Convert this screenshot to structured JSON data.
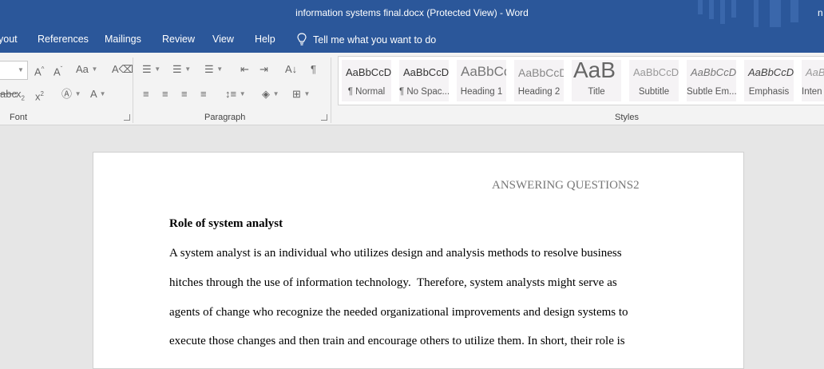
{
  "window": {
    "title": "information systems final.docx (Protected View)  -  Word",
    "user_initial": "n"
  },
  "tabs": [
    "yout",
    "References",
    "Mailings",
    "Review",
    "View",
    "Help"
  ],
  "tell_me": "Tell me what you want to do",
  "ribbon": {
    "groups": {
      "font": "Font",
      "paragraph": "Paragraph",
      "styles": "Styles"
    },
    "styles": [
      {
        "sample": "AaBbCcDc",
        "name": "¶ Normal"
      },
      {
        "sample": "AaBbCcDc",
        "name": "¶ No Spac..."
      },
      {
        "sample": "AaBbCc",
        "name": "Heading 1"
      },
      {
        "sample": "AaBbCcD",
        "name": "Heading 2"
      },
      {
        "sample": "AaB",
        "name": "Title"
      },
      {
        "sample": "AaBbCcD",
        "name": "Subtitle"
      },
      {
        "sample": "AaBbCcDc",
        "name": "Subtle Em..."
      },
      {
        "sample": "AaBbCcDc",
        "name": "Emphasis"
      },
      {
        "sample": "AaBbCcDc",
        "name": "Inten"
      }
    ]
  },
  "document": {
    "header": "ANSWERING QUESTIONS2",
    "heading": "Role of system analyst",
    "lines": [
      "A system analyst is an individual who utilizes design and analysis methods to resolve business",
      "hitches through the use of information technology.  Therefore, system analysts might serve as",
      "agents of change who recognize the needed organizational improvements and design systems to",
      "execute those changes and then train and encourage others to utilize them. In short, their role is"
    ]
  }
}
